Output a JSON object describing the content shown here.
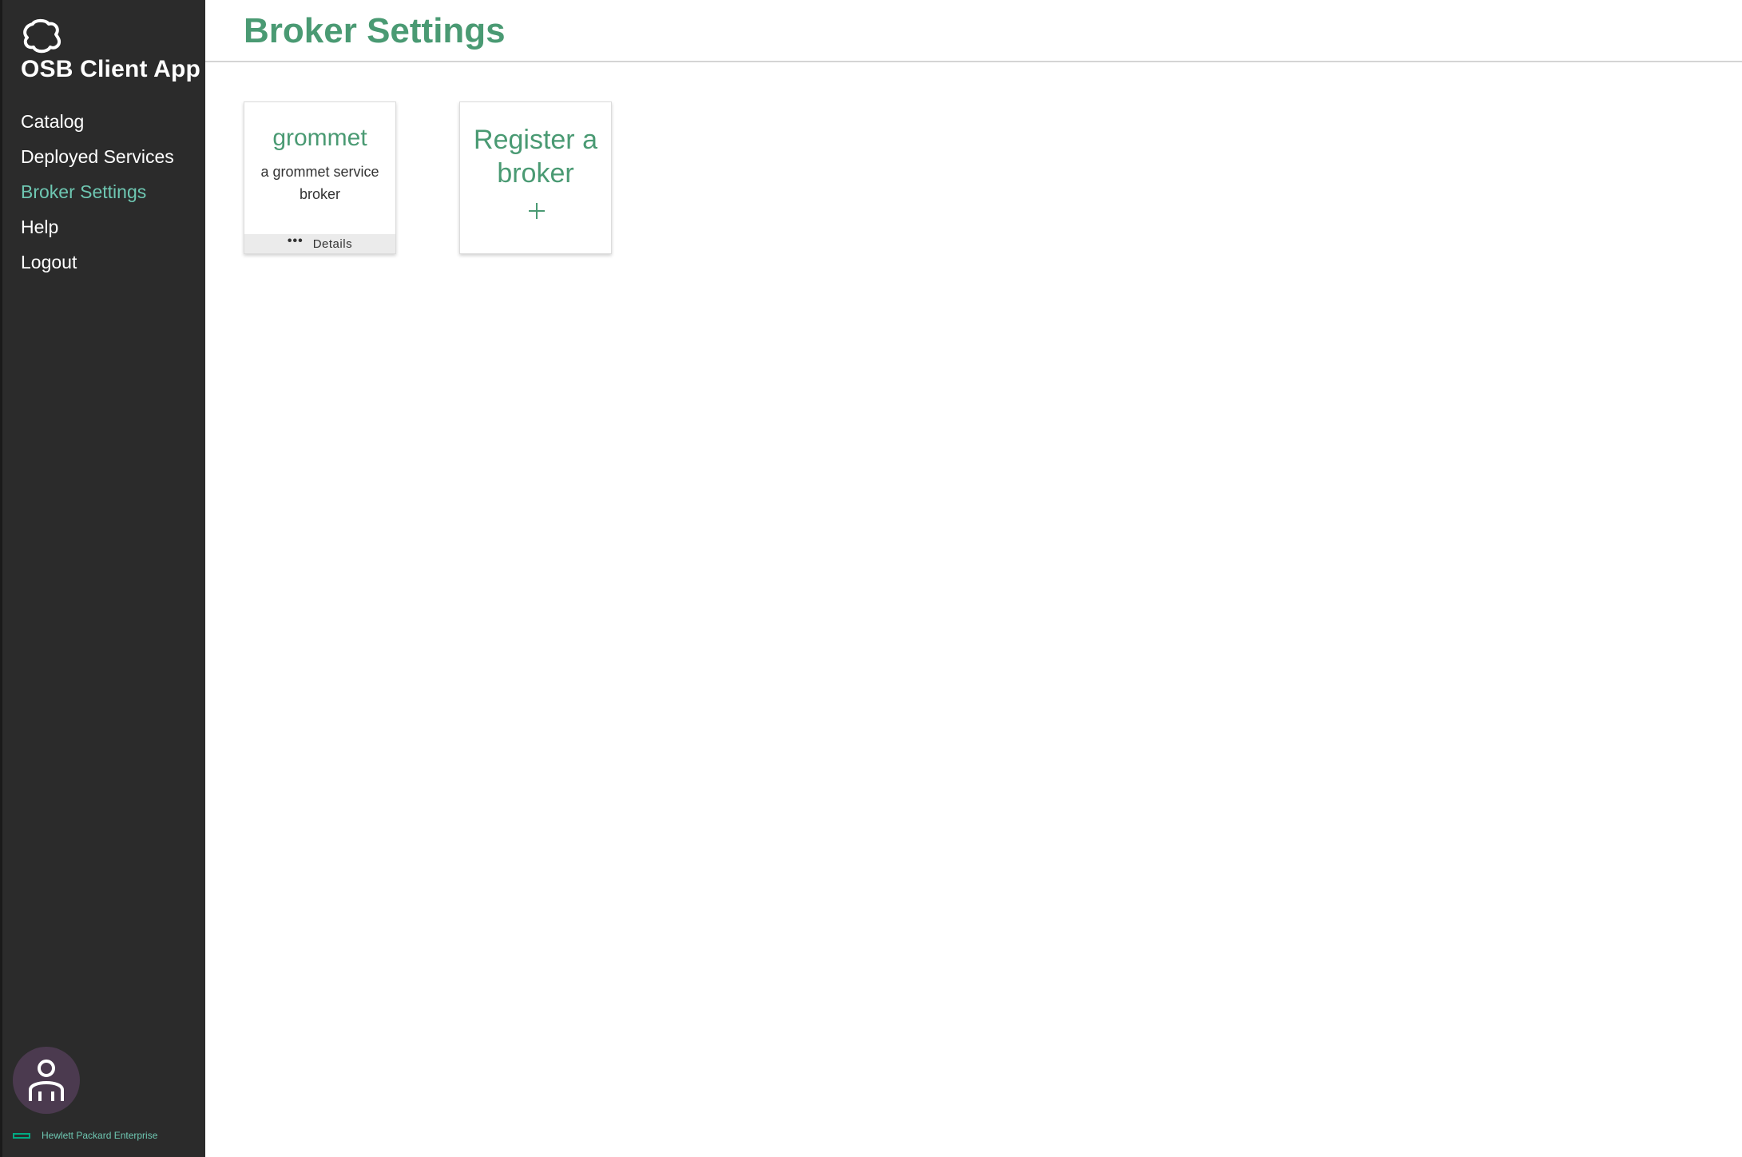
{
  "app": {
    "title": "OSB Client App",
    "logo_icon": "cloud-icon",
    "accent_color": "#4a9a73",
    "sidebar_bg": "#2b2b2b"
  },
  "nav": {
    "items": [
      {
        "label": "Catalog",
        "active": false
      },
      {
        "label": "Deployed Services",
        "active": false
      },
      {
        "label": "Broker Settings",
        "active": true
      },
      {
        "label": "Help",
        "active": false
      },
      {
        "label": "Logout",
        "active": false
      }
    ]
  },
  "user": {
    "avatar_icon": "user-icon"
  },
  "footer": {
    "brand": "Hewlett Packard Enterprise"
  },
  "page": {
    "title": "Broker Settings"
  },
  "brokers": [
    {
      "name": "grommet",
      "description": "a grommet service broker",
      "details_label": "Details",
      "more_icon": "more-dots-icon"
    }
  ],
  "register": {
    "label": "Register a broker",
    "icon": "plus-icon"
  }
}
